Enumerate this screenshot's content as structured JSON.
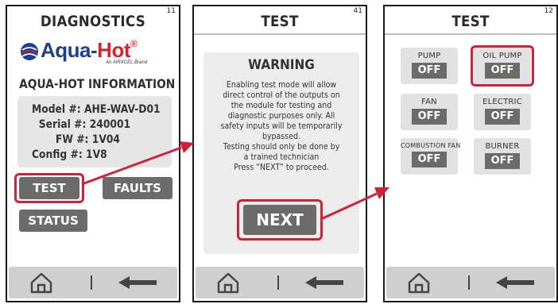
{
  "screens": [
    {
      "title": "DIAGNOSTICS",
      "number": "11",
      "logo": {
        "brand_part1": "Aqua",
        "brand_part2": "Hot",
        "registered": "®",
        "tagline": "An AIRXCEL Brand"
      },
      "heading": "AQUA-HOT INFORMATION",
      "info": {
        "model": "Model #: AHE-WAV-D01",
        "serial": "Serial #: 240001",
        "fw": "FW #: 1V04",
        "config": "Config #: 1V8"
      },
      "buttons": {
        "test": "TEST",
        "faults": "FAULTS",
        "status": "STATUS"
      }
    },
    {
      "title": "TEST",
      "number": "41",
      "warning": {
        "title": "WARNING",
        "lines": [
          "Enabling test mode will allow",
          "direct control of the outputs on",
          "the module for testing and",
          "diagnostic purposes only. All",
          "safety inputs will be temporarily",
          "bypassed.",
          "Testing should only be done by",
          "a trained technician",
          "Press “NEXT” to proceed."
        ]
      },
      "next_button": "NEXT"
    },
    {
      "title": "TEST",
      "number": "12",
      "controls": [
        {
          "label": "PUMP",
          "state": "OFF"
        },
        {
          "label": "OIL PUMP",
          "state": "OFF"
        },
        {
          "label": "FAN",
          "state": "OFF"
        },
        {
          "label": "ELECTRIC",
          "state": "OFF"
        },
        {
          "label": "COMBUSTION FAN",
          "state": "OFF"
        },
        {
          "label": "BURNER",
          "state": "OFF"
        }
      ]
    }
  ],
  "nav": {
    "separator": "|",
    "home_icon": "home-icon",
    "back_icon": "back-arrow-icon"
  },
  "colors": {
    "highlight": "#d0203a",
    "button": "#6b6b6b",
    "panel": "#e6e6e6",
    "navbar": "#cfcfcf",
    "brand_blue": "#1d3f8f",
    "brand_red": "#d4232d"
  }
}
